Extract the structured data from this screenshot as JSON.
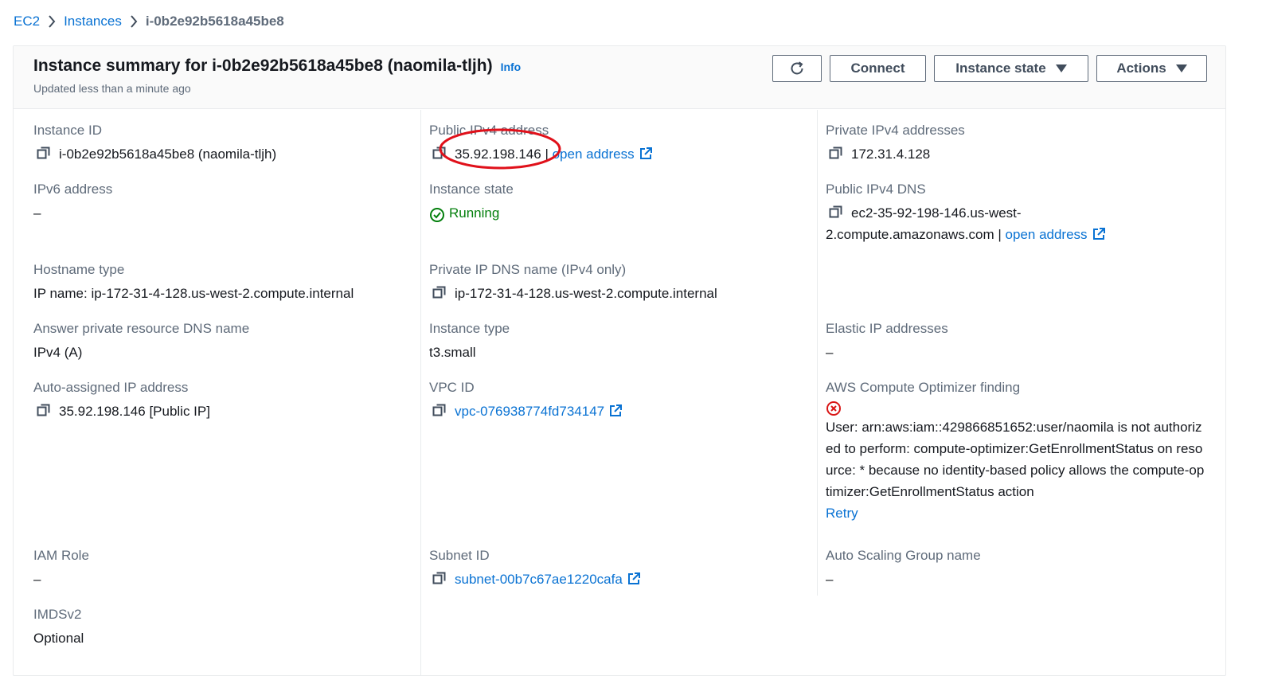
{
  "breadcrumb": {
    "root": "EC2",
    "instances": "Instances",
    "current": "i-0b2e92b5618a45be8"
  },
  "header": {
    "title": "Instance summary for i-0b2e92b5618a45be8 (naomila-tljh)",
    "info": "Info",
    "subtitle": "Updated less than a minute ago",
    "connect_label": "Connect",
    "instance_state_label": "Instance state",
    "actions_label": "Actions"
  },
  "col1": {
    "instance_id": {
      "label": "Instance ID",
      "value": "i-0b2e92b5618a45be8 (naomila-tljh)"
    },
    "ipv6": {
      "label": "IPv6 address",
      "value": "–"
    },
    "hostname_type": {
      "label": "Hostname type",
      "value": "IP name: ip-172-31-4-128.us-west-2.compute.internal"
    },
    "answer_dns": {
      "label": "Answer private resource DNS name",
      "value": "IPv4 (A)"
    },
    "auto_ip": {
      "label": "Auto-assigned IP address",
      "value": "35.92.198.146 [Public IP]"
    },
    "iam_role": {
      "label": "IAM Role",
      "value": "–"
    },
    "imdsv2": {
      "label": "IMDSv2",
      "value": "Optional"
    }
  },
  "col2": {
    "public_ipv4": {
      "label": "Public IPv4 address",
      "value": "35.92.198.146",
      "sep": " | ",
      "link": "open address"
    },
    "instance_state": {
      "label": "Instance state",
      "value": "Running"
    },
    "private_dns": {
      "label": "Private IP DNS name (IPv4 only)",
      "value": "ip-172-31-4-128.us-west-2.compute.internal"
    },
    "instance_type": {
      "label": "Instance type",
      "value": "t3.small"
    },
    "vpc": {
      "label": "VPC ID",
      "value": "vpc-076938774fd734147"
    },
    "subnet": {
      "label": "Subnet ID",
      "value": "subnet-00b7c67ae1220cafa"
    }
  },
  "col3": {
    "private_ipv4": {
      "label": "Private IPv4 addresses",
      "value": "172.31.4.128"
    },
    "public_dns": {
      "label": "Public IPv4 DNS",
      "value_line1": "ec2-35-92-198-146.us-west-",
      "value_line2": "2.compute.amazonaws.com",
      "sep": " | ",
      "link": "open address"
    },
    "elastic_ip": {
      "label": "Elastic IP addresses",
      "value": "–"
    },
    "optimizer": {
      "label": "AWS Compute Optimizer finding",
      "message": "User: arn:aws:iam::429866851652:user/naomila is not authorized to perform: compute-optimizer:GetEnrollmentStatus on resource: * because no identity-based policy allows the compute-optimizer:GetEnrollmentStatus action",
      "retry": "Retry"
    },
    "asg": {
      "label": "Auto Scaling Group name",
      "value": "–"
    }
  },
  "colors": {
    "link": "#0972d3",
    "success": "#037f0c",
    "error": "#d91515",
    "annotation": "#e0101a"
  },
  "icons": [
    "chevron-right-icon",
    "refresh-icon",
    "caret-down-icon",
    "copy-icon",
    "external-link-icon",
    "status-running-icon",
    "error-icon"
  ]
}
